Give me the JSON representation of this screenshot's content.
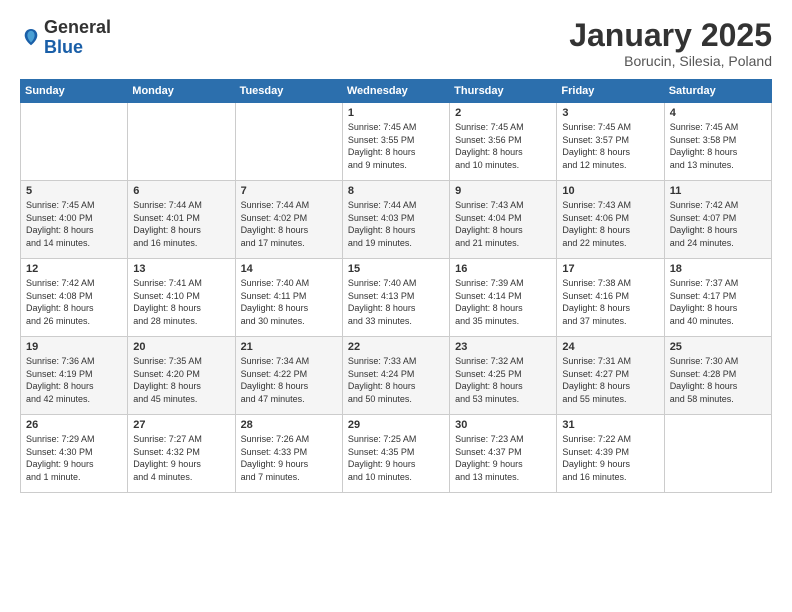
{
  "logo": {
    "general": "General",
    "blue": "Blue"
  },
  "header": {
    "title": "January 2025",
    "subtitle": "Borucin, Silesia, Poland"
  },
  "weekdays": [
    "Sunday",
    "Monday",
    "Tuesday",
    "Wednesday",
    "Thursday",
    "Friday",
    "Saturday"
  ],
  "weeks": [
    [
      {
        "day": "",
        "info": ""
      },
      {
        "day": "",
        "info": ""
      },
      {
        "day": "",
        "info": ""
      },
      {
        "day": "1",
        "info": "Sunrise: 7:45 AM\nSunset: 3:55 PM\nDaylight: 8 hours\nand 9 minutes."
      },
      {
        "day": "2",
        "info": "Sunrise: 7:45 AM\nSunset: 3:56 PM\nDaylight: 8 hours\nand 10 minutes."
      },
      {
        "day": "3",
        "info": "Sunrise: 7:45 AM\nSunset: 3:57 PM\nDaylight: 8 hours\nand 12 minutes."
      },
      {
        "day": "4",
        "info": "Sunrise: 7:45 AM\nSunset: 3:58 PM\nDaylight: 8 hours\nand 13 minutes."
      }
    ],
    [
      {
        "day": "5",
        "info": "Sunrise: 7:45 AM\nSunset: 4:00 PM\nDaylight: 8 hours\nand 14 minutes."
      },
      {
        "day": "6",
        "info": "Sunrise: 7:44 AM\nSunset: 4:01 PM\nDaylight: 8 hours\nand 16 minutes."
      },
      {
        "day": "7",
        "info": "Sunrise: 7:44 AM\nSunset: 4:02 PM\nDaylight: 8 hours\nand 17 minutes."
      },
      {
        "day": "8",
        "info": "Sunrise: 7:44 AM\nSunset: 4:03 PM\nDaylight: 8 hours\nand 19 minutes."
      },
      {
        "day": "9",
        "info": "Sunrise: 7:43 AM\nSunset: 4:04 PM\nDaylight: 8 hours\nand 21 minutes."
      },
      {
        "day": "10",
        "info": "Sunrise: 7:43 AM\nSunset: 4:06 PM\nDaylight: 8 hours\nand 22 minutes."
      },
      {
        "day": "11",
        "info": "Sunrise: 7:42 AM\nSunset: 4:07 PM\nDaylight: 8 hours\nand 24 minutes."
      }
    ],
    [
      {
        "day": "12",
        "info": "Sunrise: 7:42 AM\nSunset: 4:08 PM\nDaylight: 8 hours\nand 26 minutes."
      },
      {
        "day": "13",
        "info": "Sunrise: 7:41 AM\nSunset: 4:10 PM\nDaylight: 8 hours\nand 28 minutes."
      },
      {
        "day": "14",
        "info": "Sunrise: 7:40 AM\nSunset: 4:11 PM\nDaylight: 8 hours\nand 30 minutes."
      },
      {
        "day": "15",
        "info": "Sunrise: 7:40 AM\nSunset: 4:13 PM\nDaylight: 8 hours\nand 33 minutes."
      },
      {
        "day": "16",
        "info": "Sunrise: 7:39 AM\nSunset: 4:14 PM\nDaylight: 8 hours\nand 35 minutes."
      },
      {
        "day": "17",
        "info": "Sunrise: 7:38 AM\nSunset: 4:16 PM\nDaylight: 8 hours\nand 37 minutes."
      },
      {
        "day": "18",
        "info": "Sunrise: 7:37 AM\nSunset: 4:17 PM\nDaylight: 8 hours\nand 40 minutes."
      }
    ],
    [
      {
        "day": "19",
        "info": "Sunrise: 7:36 AM\nSunset: 4:19 PM\nDaylight: 8 hours\nand 42 minutes."
      },
      {
        "day": "20",
        "info": "Sunrise: 7:35 AM\nSunset: 4:20 PM\nDaylight: 8 hours\nand 45 minutes."
      },
      {
        "day": "21",
        "info": "Sunrise: 7:34 AM\nSunset: 4:22 PM\nDaylight: 8 hours\nand 47 minutes."
      },
      {
        "day": "22",
        "info": "Sunrise: 7:33 AM\nSunset: 4:24 PM\nDaylight: 8 hours\nand 50 minutes."
      },
      {
        "day": "23",
        "info": "Sunrise: 7:32 AM\nSunset: 4:25 PM\nDaylight: 8 hours\nand 53 minutes."
      },
      {
        "day": "24",
        "info": "Sunrise: 7:31 AM\nSunset: 4:27 PM\nDaylight: 8 hours\nand 55 minutes."
      },
      {
        "day": "25",
        "info": "Sunrise: 7:30 AM\nSunset: 4:28 PM\nDaylight: 8 hours\nand 58 minutes."
      }
    ],
    [
      {
        "day": "26",
        "info": "Sunrise: 7:29 AM\nSunset: 4:30 PM\nDaylight: 9 hours\nand 1 minute."
      },
      {
        "day": "27",
        "info": "Sunrise: 7:27 AM\nSunset: 4:32 PM\nDaylight: 9 hours\nand 4 minutes."
      },
      {
        "day": "28",
        "info": "Sunrise: 7:26 AM\nSunset: 4:33 PM\nDaylight: 9 hours\nand 7 minutes."
      },
      {
        "day": "29",
        "info": "Sunrise: 7:25 AM\nSunset: 4:35 PM\nDaylight: 9 hours\nand 10 minutes."
      },
      {
        "day": "30",
        "info": "Sunrise: 7:23 AM\nSunset: 4:37 PM\nDaylight: 9 hours\nand 13 minutes."
      },
      {
        "day": "31",
        "info": "Sunrise: 7:22 AM\nSunset: 4:39 PM\nDaylight: 9 hours\nand 16 minutes."
      },
      {
        "day": "",
        "info": ""
      }
    ]
  ]
}
